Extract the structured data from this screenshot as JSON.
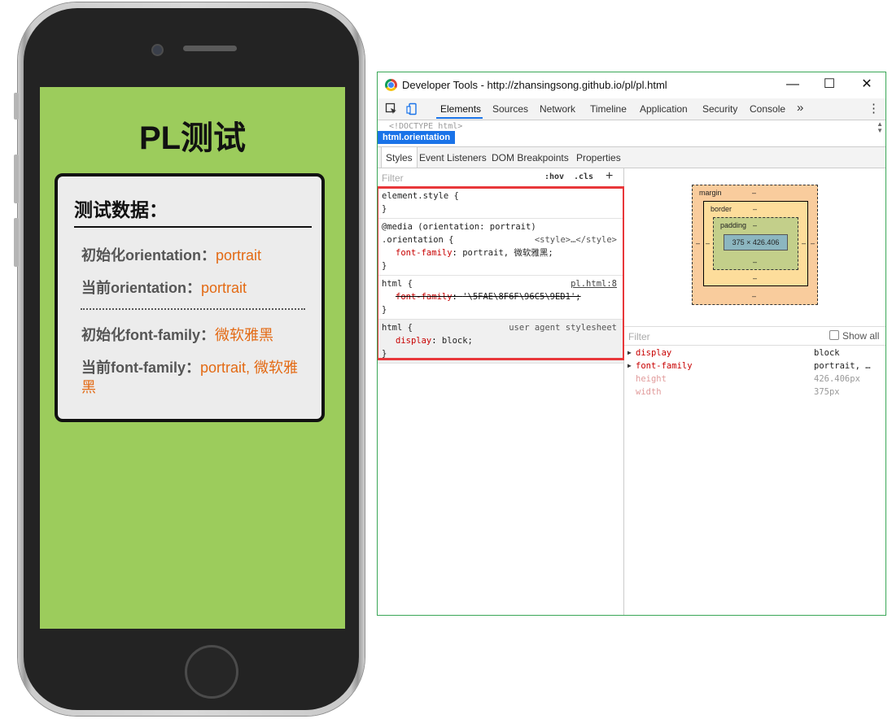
{
  "phone": {
    "title": "PL测试",
    "card": {
      "heading": "测试数据：",
      "rows": [
        {
          "label": "初始化orientation：",
          "value": "portrait"
        },
        {
          "label": "当前orientation：",
          "value": "portrait"
        },
        {
          "label": "初始化font-family：",
          "value": "微软雅黑"
        },
        {
          "label": "当前font-family：",
          "value": "portrait, 微软雅黑"
        }
      ]
    },
    "colors": {
      "screen": "#9ccc5c",
      "accent": "#e36a14"
    }
  },
  "devtools": {
    "window_title": "Developer Tools - http://zhansingsong.github.io/pl/pl.html",
    "window_buttons": {
      "minimize": "—",
      "maximize": "☐",
      "close": "✕"
    },
    "tabs": [
      "Elements",
      "Sources",
      "Network",
      "Timeline",
      "Application",
      "Security",
      "Console"
    ],
    "more_tabs": "»",
    "menu": "⋮",
    "doctype": "<!DOCTYPE html>",
    "breadcrumb": "html.orientation",
    "subtabs": [
      "Styles",
      "Event Listeners",
      "DOM Breakpoints",
      "Properties"
    ],
    "styles_filter_placeholder": "Filter",
    "hov": ":hov",
    "cls": ".cls",
    "plus": "+",
    "rules": {
      "element_style": {
        "selector": "element.style {",
        "close": "}"
      },
      "media": {
        "media": "@media (orientation: portrait)",
        "selector": ".orientation {",
        "source": "<style>…</style>",
        "prop": "font-family",
        "value": "portrait, 微软雅黑;",
        "close": "}"
      },
      "html_author": {
        "selector": "html {",
        "source": "pl.html:8",
        "prop": "font-family",
        "value": "'\\5FAE\\8F6F\\96C5\\9ED1';",
        "close": "}"
      },
      "html_ua": {
        "selector": "html {",
        "source": "user agent stylesheet",
        "prop": "display",
        "value": "block;",
        "close": "}"
      }
    },
    "box_model": {
      "margin": "margin",
      "margin_val": "–",
      "border": "border",
      "border_val": "–",
      "padding": "padding",
      "padding_val": "–",
      "content": "375 × 426.406",
      "side": "–"
    },
    "computed_filter_placeholder": "Filter",
    "show_all": "Show all",
    "computed": [
      {
        "name": "display",
        "value": "block"
      },
      {
        "name": "font-family",
        "value": "portrait, …"
      },
      {
        "name": "height",
        "value": "426.406px"
      },
      {
        "name": "width",
        "value": "375px"
      }
    ]
  }
}
